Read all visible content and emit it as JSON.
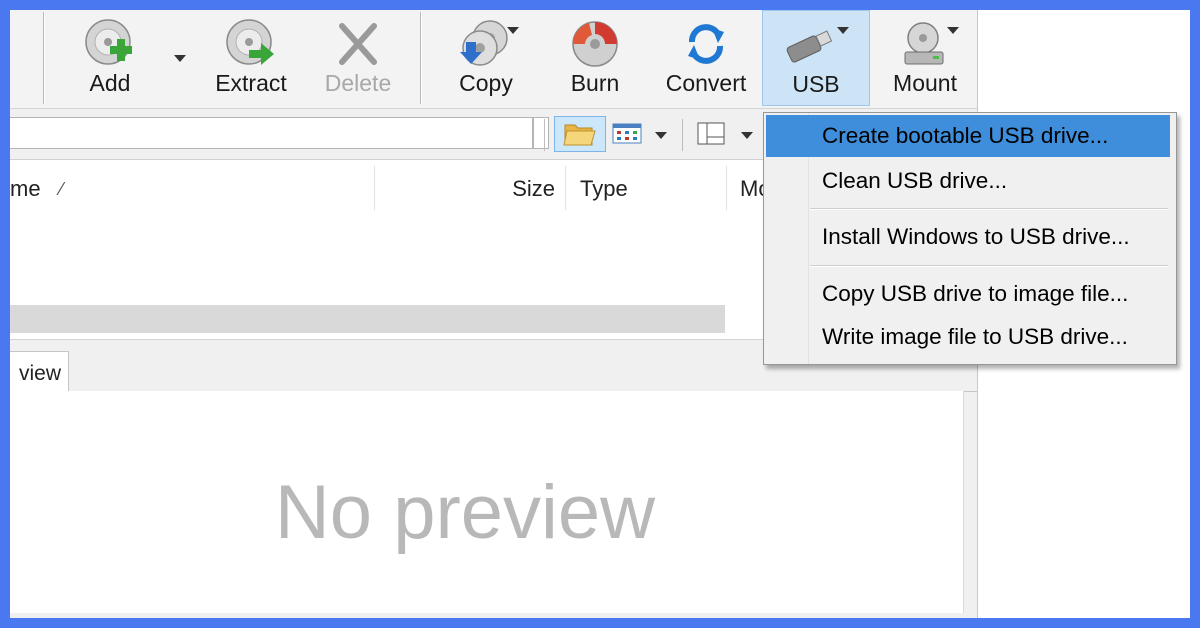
{
  "toolbar": {
    "add_label": "Add",
    "extract_label": "Extract",
    "delete_label": "Delete",
    "copy_label": "Copy",
    "burn_label": "Burn",
    "convert_label": "Convert",
    "usb_label": "USB",
    "mount_label": "Mount"
  },
  "columns": {
    "name_label": "me",
    "sort_indicator": "⁄",
    "size_label": "Size",
    "type_label": "Type",
    "modified_label": "Mo"
  },
  "preview": {
    "tab_label": "view",
    "placeholder": "No preview"
  },
  "usb_menu": {
    "items": [
      {
        "label": "Create bootable USB drive...",
        "highlighted": true
      },
      {
        "label": "Clean USB drive..."
      },
      {
        "label": "Install Windows to USB drive..."
      },
      {
        "label": "Copy USB drive to image file..."
      },
      {
        "label": "Write image file to USB drive..."
      }
    ]
  },
  "colors": {
    "frame": "#4a78f0",
    "menu_highlight": "#3e8edb",
    "active_button": "#cde4f7"
  }
}
